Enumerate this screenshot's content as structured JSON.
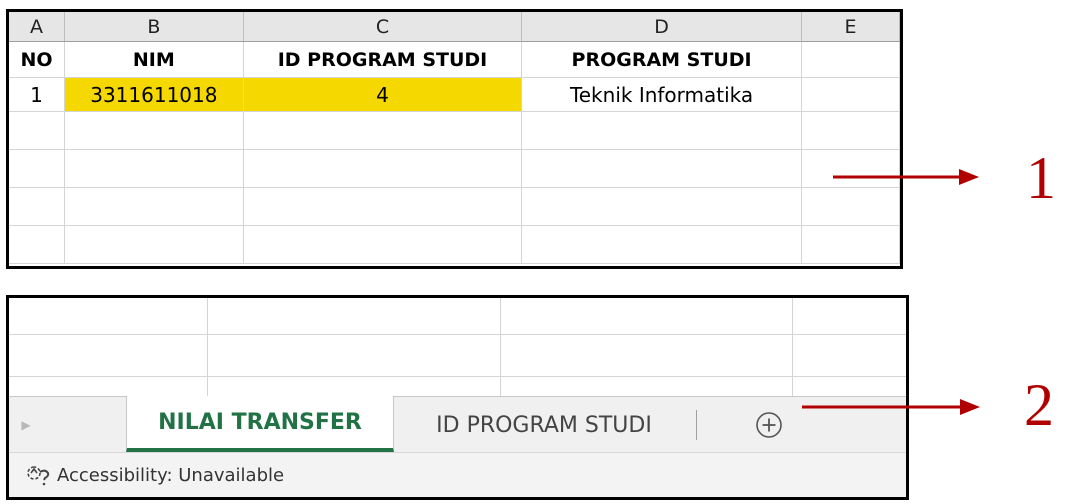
{
  "sheet": {
    "column_headers": [
      "A",
      "B",
      "C",
      "D",
      "E"
    ],
    "header_row": [
      "NO",
      "NIM",
      "ID PROGRAM STUDI",
      "PROGRAM STUDI",
      ""
    ],
    "data_row": [
      "1",
      "3311611018",
      "4",
      "Teknik Informatika",
      ""
    ],
    "highlight_color": "#f5d800"
  },
  "tabs": {
    "active_label": "NILAI TRANSFER",
    "inactive_label": "ID PROGRAM STUDI",
    "scroll_icon": "triangle-right-icon",
    "add_icon": "plus-circle-icon"
  },
  "status": {
    "accessibility_text": "Accessibility: Unavailable",
    "icon": "accessibility-icon"
  },
  "annotations": {
    "label_1": "1",
    "label_2": "2",
    "color": "#b00000"
  }
}
